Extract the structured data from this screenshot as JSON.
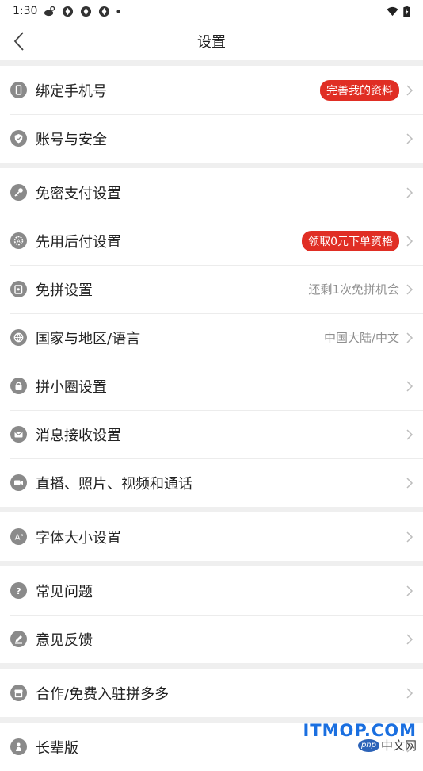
{
  "status": {
    "time": "1:30"
  },
  "nav": {
    "title": "设置"
  },
  "groups": [
    [
      {
        "icon": "phone-icon",
        "label": "绑定手机号",
        "badge": "完善我的资料"
      },
      {
        "icon": "shield-icon",
        "label": "账号与安全"
      }
    ],
    [
      {
        "icon": "key-icon",
        "label": "免密支付设置"
      },
      {
        "icon": "gear-badge-icon",
        "label": "先用后付设置",
        "badge": "领取0元下单资格"
      },
      {
        "icon": "card-icon",
        "label": "免拼设置",
        "hint": "还剩1次免拼机会"
      },
      {
        "icon": "globe-icon",
        "label": "国家与地区/语言",
        "hint": "中国大陆/中文"
      },
      {
        "icon": "lock-icon",
        "label": "拼小圈设置"
      },
      {
        "icon": "mail-icon",
        "label": "消息接收设置"
      },
      {
        "icon": "camera-icon",
        "label": "直播、照片、视频和通话"
      }
    ],
    [
      {
        "icon": "font-size-icon",
        "label": "字体大小设置"
      }
    ],
    [
      {
        "icon": "question-icon",
        "label": "常见问题"
      },
      {
        "icon": "pencil-icon",
        "label": "意见反馈"
      }
    ],
    [
      {
        "icon": "store-icon",
        "label": "合作/免费入驻拼多多"
      }
    ],
    [
      {
        "icon": "elder-icon",
        "label": "长辈版"
      }
    ]
  ],
  "watermark": {
    "top": "ITMOP.COM",
    "php": "php",
    "cn": "中文网"
  },
  "colors": {
    "accent": "#e02e24",
    "icon_bg": "#8a8a8a",
    "hint": "#8f8f8f"
  }
}
